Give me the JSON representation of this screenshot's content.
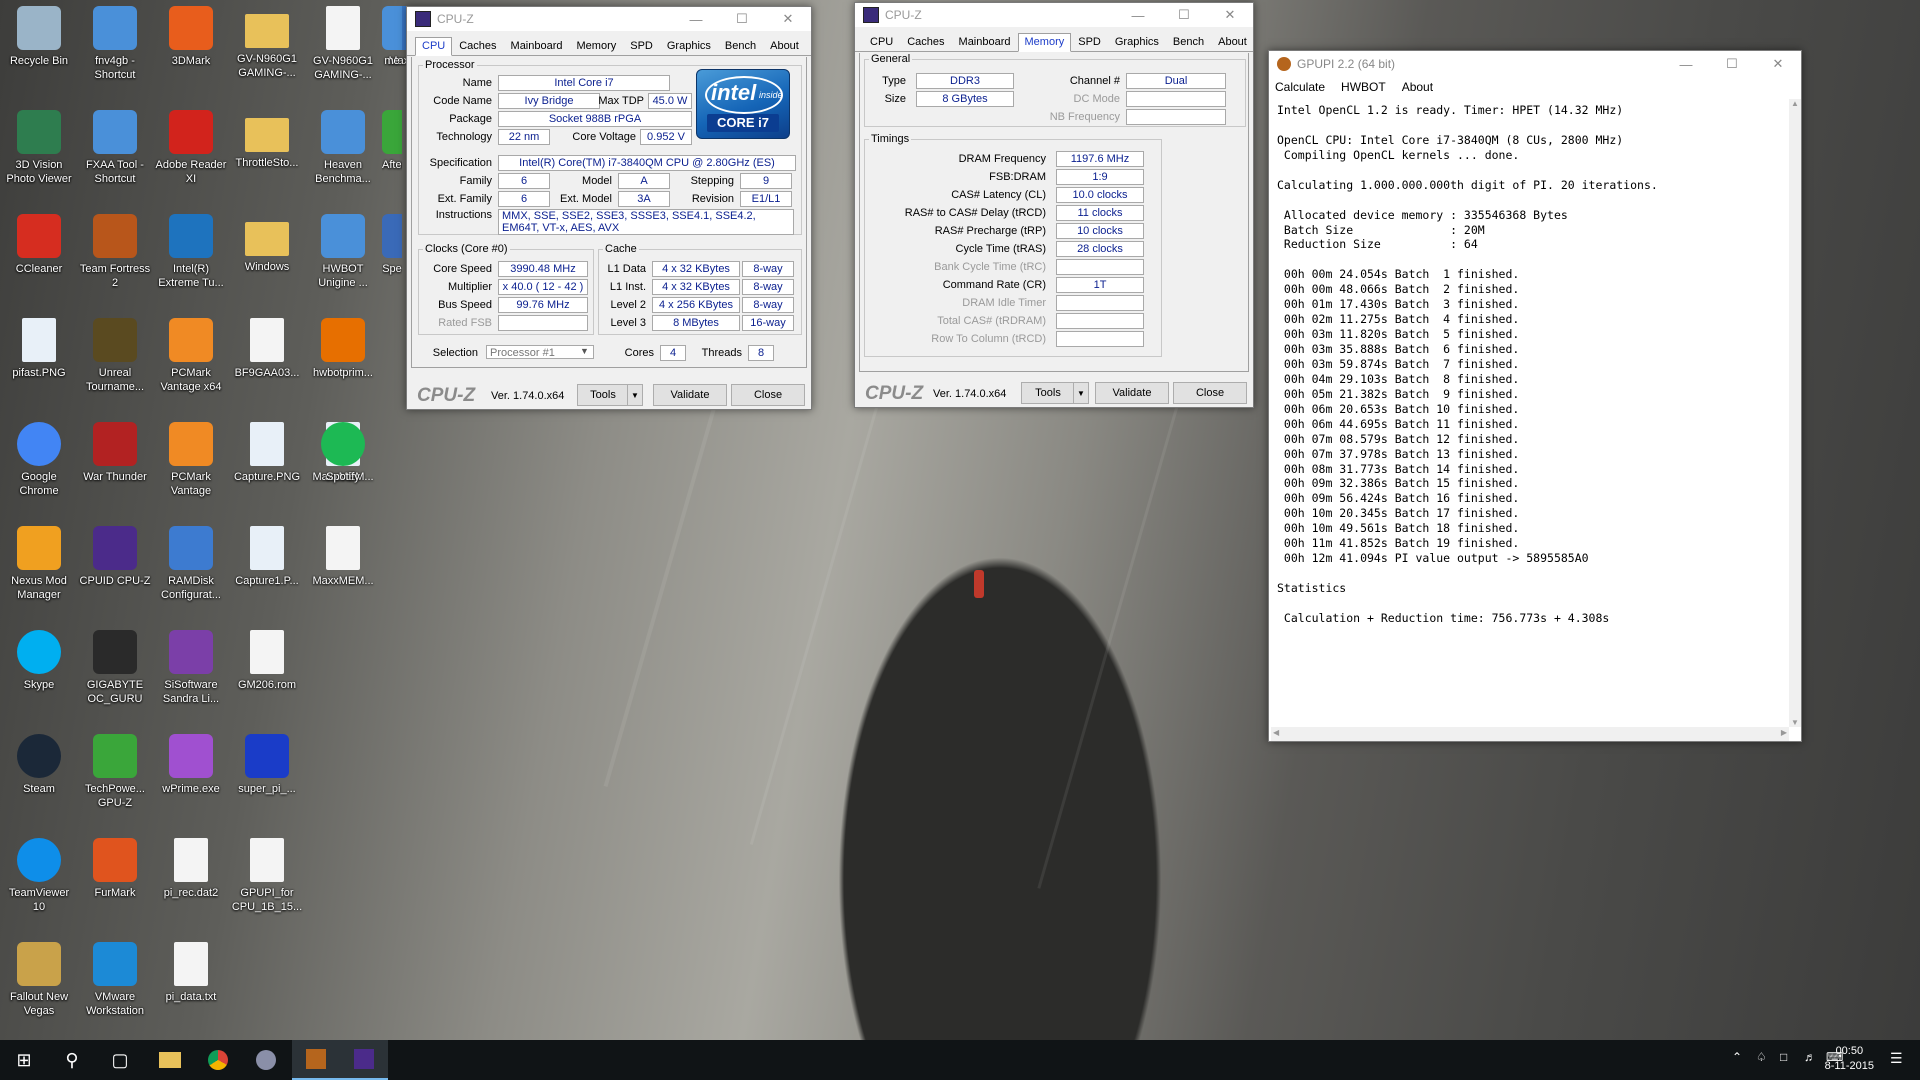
{
  "desktop": {
    "icons": [
      {
        "label": "Recycle Bin",
        "icon": "recycle-bin-icon",
        "color": "#9ab4c8"
      },
      {
        "label": "Photo Viewer",
        "prefix": "3D Vision",
        "icon": "photo-viewer-icon",
        "color": "#2e7d4f"
      },
      {
        "label": "CCleaner",
        "icon": "ccleaner-icon",
        "color": "#d62d20"
      },
      {
        "label": "pifast.PNG",
        "icon": "image-file-icon",
        "color": "#e8f0f8"
      },
      {
        "label": "Google Chrome",
        "icon": "chrome-icon",
        "color": "#4285f4"
      },
      {
        "label": "Nexus Mod Manager",
        "icon": "nexus-icon",
        "color": "#f0a020"
      },
      {
        "label": "Skype",
        "icon": "skype-icon",
        "color": "#00aff0"
      },
      {
        "label": "Steam",
        "icon": "steam-icon",
        "color": "#1b2838"
      },
      {
        "label": "TeamViewer 10",
        "icon": "teamviewer-icon",
        "color": "#0e8ee9"
      },
      {
        "label": "Fallout New Vegas",
        "icon": "fallout-icon",
        "color": "#c9a24a"
      },
      {
        "label": "fnv4gb - Shortcut",
        "icon": "app-shortcut-icon",
        "color": "#4a90d9"
      },
      {
        "label": "FXAA Tool - Shortcut",
        "icon": "app-shortcut-icon",
        "color": "#4a90d9"
      },
      {
        "label": "Team Fortress 2",
        "icon": "tf2-icon",
        "color": "#b8561b"
      },
      {
        "label": "Unreal Tourname...",
        "icon": "unreal-icon",
        "color": "#5a4a20"
      },
      {
        "label": "War Thunder",
        "icon": "war-thunder-icon",
        "color": "#b22222"
      },
      {
        "label": "CPUID CPU-Z",
        "icon": "cpuz-icon",
        "color": "#4b2b8a"
      },
      {
        "label": "GIGABYTE OC_GURU",
        "icon": "gigabyte-icon",
        "color": "#2a2a2a"
      },
      {
        "label": "TechPowe... GPU-Z",
        "icon": "gpuz-icon",
        "color": "#3aa63a"
      },
      {
        "label": "FurMark",
        "icon": "furmark-icon",
        "color": "#e0541e"
      },
      {
        "label": "VMware Workstation",
        "icon": "vmware-icon",
        "color": "#1c8ad6"
      },
      {
        "label": "3DMark",
        "icon": "3dmark-icon",
        "color": "#e85d1c"
      },
      {
        "label": "Adobe Reader XI",
        "icon": "adobe-reader-icon",
        "color": "#d2231c"
      },
      {
        "label": "Intel(R) Extreme Tu...",
        "icon": "intel-xtu-icon",
        "color": "#1e73be"
      },
      {
        "label": "PCMark Vantage x64",
        "icon": "pcmark-icon",
        "color": "#f08a24"
      },
      {
        "label": "PCMark Vantage",
        "icon": "pcmark-icon",
        "color": "#f08a24"
      },
      {
        "label": "RAMDisk Configurat...",
        "icon": "ramdisk-icon",
        "color": "#3d7bd0"
      },
      {
        "label": "SiSoftware Sandra Li...",
        "icon": "sandra-icon",
        "color": "#7b3fa8"
      },
      {
        "label": "wPrime.exe",
        "icon": "wprime-icon",
        "color": "#a050d0"
      },
      {
        "label": "pi_rec.dat2",
        "icon": "file-icon",
        "color": "#f4f4f4"
      },
      {
        "label": "pi_data.txt",
        "icon": "text-file-icon",
        "color": "#f4f4f4"
      },
      {
        "label": "GV-N960G1 GAMING-...",
        "icon": "folder-icon",
        "color": "#e8c15a"
      },
      {
        "label": "ThrottleSto...",
        "icon": "folder-icon",
        "color": "#e8c15a"
      },
      {
        "label": "Windows",
        "icon": "folder-icon",
        "color": "#e8c15a"
      },
      {
        "label": "BF9GAA03...",
        "icon": "file-icon",
        "color": "#f4f4f4"
      },
      {
        "label": "Capture.PNG",
        "icon": "image-file-icon",
        "color": "#e8f0f8"
      },
      {
        "label": "Capture1.P...",
        "icon": "image-file-icon",
        "color": "#e8f0f8"
      },
      {
        "label": "GM206.rom",
        "icon": "file-icon",
        "color": "#f4f4f4"
      },
      {
        "label": "super_pi_...",
        "icon": "super-pi-icon",
        "color": "#1a3cc8"
      },
      {
        "label": "GPUPI_for CPU_1B_15...",
        "icon": "file-icon",
        "color": "#f4f4f4"
      },
      {
        "label": "GV-N960G1 GAMING-...",
        "icon": "file-icon",
        "color": "#f4f4f4"
      },
      {
        "label": "Heaven Benchma...",
        "icon": "app-shortcut-icon",
        "color": "#4a90d9"
      },
      {
        "label": "HWBOT Unigine ...",
        "icon": "app-shortcut-icon",
        "color": "#4a90d9"
      },
      {
        "label": "hwbotprim...",
        "icon": "java-icon",
        "color": "#e76f00"
      },
      {
        "label": "MaxxMEM...",
        "icon": "image-file-icon",
        "color": "#e8f0f8"
      },
      {
        "label": "MaxxMEM...",
        "icon": "file-icon",
        "color": "#f4f4f4"
      },
      {
        "label": "MaxxMEM...",
        "icon": "maxxmem-icon",
        "color": "#3a78c8"
      },
      {
        "label": "me",
        "icon": "app-shortcut-icon",
        "color": "#4a90d9"
      },
      {
        "label": "Aften",
        "icon": "app-shortcut-icon",
        "color": "#3aa63a"
      },
      {
        "label": "Spe",
        "icon": "app-shortcut-icon",
        "color": "#3a6ab8"
      },
      {
        "label": "Spotify",
        "icon": "spotify-icon",
        "color": "#1db954"
      }
    ]
  },
  "cpuz1": {
    "title": "CPU-Z",
    "tabs": [
      "CPU",
      "Caches",
      "Mainboard",
      "Memory",
      "SPD",
      "Graphics",
      "Bench",
      "About"
    ],
    "selected_tab": "CPU",
    "processor": {
      "legend": "Processor",
      "name_label": "Name",
      "name": "Intel Core i7",
      "codename_label": "Code Name",
      "codename": "Ivy Bridge",
      "maxtdp_label": "Max TDP",
      "maxtdp": "45.0 W",
      "package_label": "Package",
      "package": "Socket 988B rPGA",
      "technology_label": "Technology",
      "technology": "22 nm",
      "corevoltage_label": "Core Voltage",
      "corevoltage": "0.952 V",
      "spec_label": "Specification",
      "spec": "Intel(R) Core(TM) i7-3840QM CPU @ 2.80GHz (ES)",
      "family_label": "Family",
      "family": "6",
      "model_label": "Model",
      "model": "A",
      "stepping_label": "Stepping",
      "stepping": "9",
      "extfamily_label": "Ext. Family",
      "extfamily": "6",
      "extmodel_label": "Ext. Model",
      "extmodel": "3A",
      "revision_label": "Revision",
      "revision": "E1/L1",
      "instructions_label": "Instructions",
      "instructions": "MMX, SSE, SSE2, SSE3, SSSE3, SSE4.1, SSE4.2, EM64T, VT-x, AES, AVX"
    },
    "badge": {
      "brand": "intel",
      "inside": "inside",
      "line": "CORE i7"
    },
    "clocks": {
      "legend": "Clocks (Core #0)",
      "corespeed_label": "Core Speed",
      "corespeed": "3990.48 MHz",
      "multiplier_label": "Multiplier",
      "multiplier": "x 40.0 ( 12 - 42 )",
      "busspeed_label": "Bus Speed",
      "busspeed": "99.76 MHz",
      "ratedfsb_label": "Rated FSB",
      "ratedfsb": ""
    },
    "cache": {
      "legend": "Cache",
      "rows": [
        {
          "label": "L1 Data",
          "size": "4 x 32 KBytes",
          "way": "8-way"
        },
        {
          "label": "L1 Inst.",
          "size": "4 x 32 KBytes",
          "way": "8-way"
        },
        {
          "label": "Level 2",
          "size": "4 x 256 KBytes",
          "way": "8-way"
        },
        {
          "label": "Level 3",
          "size": "8 MBytes",
          "way": "16-way"
        }
      ]
    },
    "selection_label": "Selection",
    "selection": "Processor #1",
    "cores_label": "Cores",
    "cores": "4",
    "threads_label": "Threads",
    "threads": "8",
    "footer": {
      "logo": "CPU-Z",
      "version": "Ver. 1.74.0.x64",
      "tools": "Tools",
      "validate": "Validate",
      "close": "Close"
    }
  },
  "cpuz2": {
    "title": "CPU-Z",
    "tabs": [
      "CPU",
      "Caches",
      "Mainboard",
      "Memory",
      "SPD",
      "Graphics",
      "Bench",
      "About"
    ],
    "selected_tab": "Memory",
    "general": {
      "legend": "General",
      "type_label": "Type",
      "type": "DDR3",
      "size_label": "Size",
      "size": "8 GBytes",
      "channel_label": "Channel #",
      "channel": "Dual",
      "dcmode_label": "DC Mode",
      "dcmode": "",
      "nbfreq_label": "NB Frequency",
      "nbfreq": ""
    },
    "timings": {
      "legend": "Timings",
      "rows": [
        {
          "label": "DRAM Frequency",
          "value": "1197.6 MHz",
          "dim": false
        },
        {
          "label": "FSB:DRAM",
          "value": "1:9",
          "dim": false
        },
        {
          "label": "CAS# Latency (CL)",
          "value": "10.0 clocks",
          "dim": false
        },
        {
          "label": "RAS# to CAS# Delay (tRCD)",
          "value": "11 clocks",
          "dim": false
        },
        {
          "label": "RAS# Precharge (tRP)",
          "value": "10 clocks",
          "dim": false
        },
        {
          "label": "Cycle Time (tRAS)",
          "value": "28 clocks",
          "dim": false
        },
        {
          "label": "Bank Cycle Time (tRC)",
          "value": "",
          "dim": true
        },
        {
          "label": "Command Rate (CR)",
          "value": "1T",
          "dim": false
        },
        {
          "label": "DRAM Idle Timer",
          "value": "",
          "dim": true
        },
        {
          "label": "Total CAS# (tRDRAM)",
          "value": "",
          "dim": true
        },
        {
          "label": "Row To Column (tRCD)",
          "value": "",
          "dim": true
        }
      ]
    },
    "footer": {
      "logo": "CPU-Z",
      "version": "Ver. 1.74.0.x64",
      "tools": "Tools",
      "validate": "Validate",
      "close": "Close"
    }
  },
  "gpupi": {
    "title": "GPUPI 2.2 (64 bit)",
    "menu": [
      "Calculate",
      "HWBOT",
      "About"
    ],
    "lines": [
      "Intel OpenCL 1.2 is ready. Timer: HPET (14.32 MHz)",
      "",
      "OpenCL CPU: Intel Core i7-3840QM (8 CUs, 2800 MHz)",
      " Compiling OpenCL kernels ... done.",
      "",
      "Calculating 1.000.000.000th digit of PI. 20 iterations.",
      "",
      " Allocated device memory : 335546368 Bytes",
      " Batch Size              : 20M",
      " Reduction Size          : 64",
      "",
      " 00h 00m 24.054s Batch  1 finished.",
      " 00h 00m 48.066s Batch  2 finished.",
      " 00h 01m 17.430s Batch  3 finished.",
      " 00h 02m 11.275s Batch  4 finished.",
      " 00h 03m 11.820s Batch  5 finished.",
      " 00h 03m 35.888s Batch  6 finished.",
      " 00h 03m 59.874s Batch  7 finished.",
      " 00h 04m 29.103s Batch  8 finished.",
      " 00h 05m 21.382s Batch  9 finished.",
      " 00h 06m 20.653s Batch 10 finished.",
      " 00h 06m 44.695s Batch 11 finished.",
      " 00h 07m 08.579s Batch 12 finished.",
      " 00h 07m 37.978s Batch 13 finished.",
      " 00h 08m 31.773s Batch 14 finished.",
      " 00h 09m 32.386s Batch 15 finished.",
      " 00h 09m 56.424s Batch 16 finished.",
      " 00h 10m 20.345s Batch 17 finished.",
      " 00h 10m 49.561s Batch 18 finished.",
      " 00h 11m 41.852s Batch 19 finished.",
      " 00h 12m 41.094s PI value output -> 5895585A0",
      "",
      "Statistics",
      "",
      " Calculation + Reduction time: 756.773s + 4.308s"
    ]
  },
  "taskbar": {
    "time": "00:50",
    "date": "8-11-2015"
  }
}
